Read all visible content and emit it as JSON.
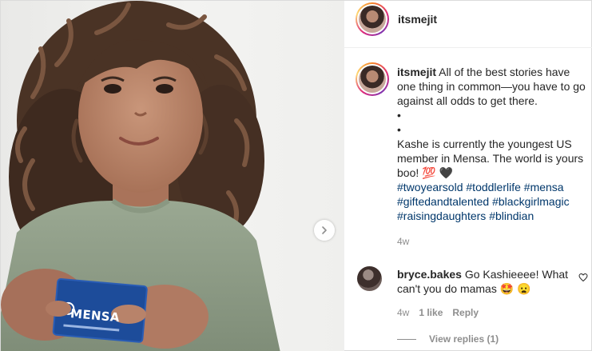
{
  "post": {
    "username": "itsmejit",
    "card_brand": "MENSA"
  },
  "caption": {
    "username": "itsmejit",
    "line1": "All of the best stories have one thing in common—you have to go against all odds to get there.",
    "dot1": "•",
    "dot2": "•",
    "line2": "Kashe is currently the youngest US member in Mensa. The world is yours boo! 💯 🖤",
    "hashtags": [
      "#twoyearsold",
      "#toddlerlife",
      "#mensa",
      "#giftedandtalented",
      "#blackgirlmagic",
      "#raisingdaughters",
      "#blindian"
    ],
    "time": "4w"
  },
  "comment": {
    "username": "bryce.bakes",
    "text": "Go Kashieeee! What can't you do mamas 🤩 😦",
    "time": "4w",
    "likes": "1 like",
    "reply_label": "Reply",
    "view_replies": "View replies (1)"
  },
  "icons": {
    "carousel_next": "chevron-right-icon",
    "like": "heart-icon"
  },
  "colors": {
    "hashtag": "#00376b",
    "muted": "#8e8e8e",
    "text": "#262626"
  }
}
